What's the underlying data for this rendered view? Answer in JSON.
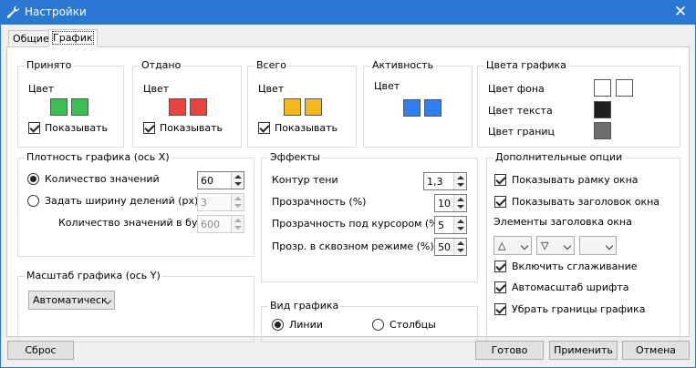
{
  "window": {
    "title": "Настройки",
    "close": "✕"
  },
  "tabs": [
    "Общие",
    "График"
  ],
  "traffic": {
    "received": {
      "title": "Принято",
      "color_label": "Цвет",
      "show_label": "Показывать",
      "colors": [
        "#3cc053",
        "#3cc053"
      ]
    },
    "sent": {
      "title": "Отдано",
      "color_label": "Цвет",
      "show_label": "Показывать",
      "colors": [
        "#e8433d",
        "#e8433d"
      ]
    },
    "total": {
      "title": "Всего",
      "color_label": "Цвет",
      "show_label": "Показывать",
      "colors": [
        "#f5b81d",
        "#f5b81d"
      ]
    },
    "activity": {
      "title": "Активность",
      "color_label": "Цвет",
      "colors": [
        "#2f7ff2",
        "#2f7ff2"
      ]
    }
  },
  "graph_colors": {
    "title": "Цвета графика",
    "background": {
      "label": "Цвет фона",
      "colors": [
        "#ffffff",
        "#ffffff"
      ]
    },
    "text": {
      "label": "Цвет текста",
      "color": "#1f1f1f"
    },
    "borders": {
      "label": "Цвет границ",
      "color": "#6e6e6e"
    }
  },
  "density": {
    "title": "Плотность графика (ось X)",
    "count_label": "Количество значений",
    "count_value": "60",
    "width_label": "Задать ширину делений (px)",
    "width_value": "3",
    "buffer_label": "Количество значений в буфере",
    "buffer_value": "600"
  },
  "scale": {
    "title": "Масштаб графика (ось Y)",
    "value": "Автоматическ"
  },
  "effects": {
    "title": "Эффекты",
    "shadow_label": "Контур тени",
    "shadow_value": "1,3",
    "transparency_label": "Прозрачность (%)",
    "transparency_value": "10",
    "hover_label": "Прозрачность под курсором (%)",
    "hover_value": "5",
    "through_label": "Прозр. в сквозном режиме (%)",
    "through_value": "50"
  },
  "view": {
    "title": "Вид графика",
    "lines_label": "Линии",
    "columns_label": "Столбцы"
  },
  "extra": {
    "title": "Дополнительные опции",
    "show_border": "Показывать рамку окна",
    "show_header": "Показывать заголовок окна",
    "header_elements": "Элементы заголовка окна",
    "combo1": "△",
    "combo2": "▽",
    "combo3": "",
    "smoothing": "Включить сглаживание",
    "autoscale_font": "Автомасштаб шрифта",
    "remove_borders": "Убрать границы графика"
  },
  "buttons": {
    "reset": "Сброс",
    "ok": "Готово",
    "apply": "Применить",
    "cancel": "Отмена"
  }
}
